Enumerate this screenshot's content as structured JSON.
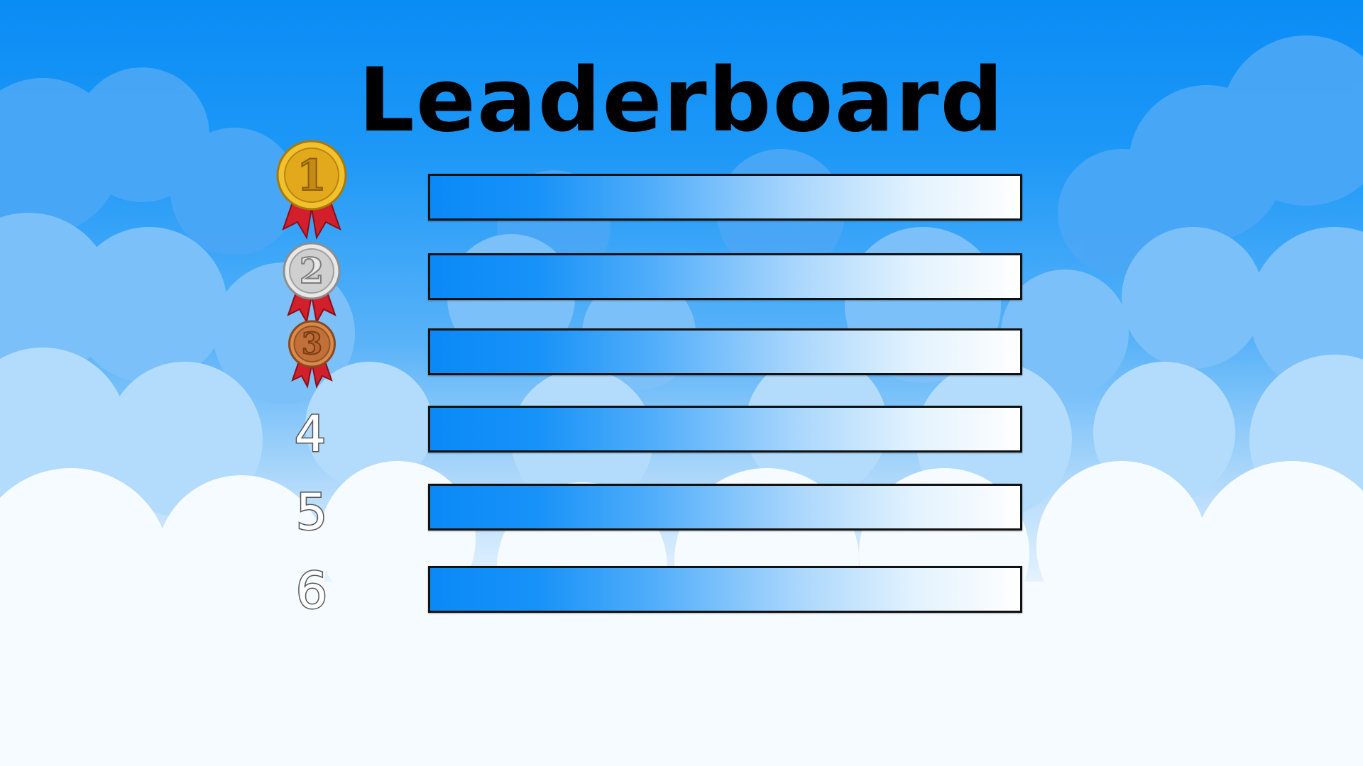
{
  "title": "Leaderboard",
  "ranks": [
    {
      "label": "1",
      "medal": "gold-medal-icon"
    },
    {
      "label": "2",
      "medal": "silver-medal-icon"
    },
    {
      "label": "3",
      "medal": "bronze-medal-icon"
    },
    {
      "label": "4"
    },
    {
      "label": "5"
    },
    {
      "label": "6"
    }
  ],
  "colors": {
    "sky_top": "#0a8cf5",
    "bar_start": "#0a89f7",
    "bar_end": "#ffffff",
    "gold": "#f2c12e",
    "silver": "#d9d9d9",
    "bronze": "#c8743d",
    "ribbon": "#d1202c"
  }
}
